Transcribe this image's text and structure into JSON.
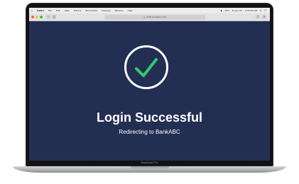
{
  "menubar": {
    "apple_icon": "apple-icon",
    "app": "Safari",
    "items": [
      "File",
      "Edit",
      "View",
      "History",
      "Bookmarks",
      "Develop",
      "Window",
      "Help"
    ],
    "status": [
      "70%",
      "Fri Jun 01",
      "2:33:56 AM"
    ]
  },
  "browser": {
    "url": "auth.bankabc.com"
  },
  "main": {
    "title": "Login Successful",
    "subtitle": "Redirecting to BankABC"
  },
  "device": {
    "label": "MacBook Pro"
  },
  "colors": {
    "screen_bg": "#232e53",
    "check": "#2ecc71",
    "ring": "#ffffff",
    "text": "#ffffff"
  }
}
